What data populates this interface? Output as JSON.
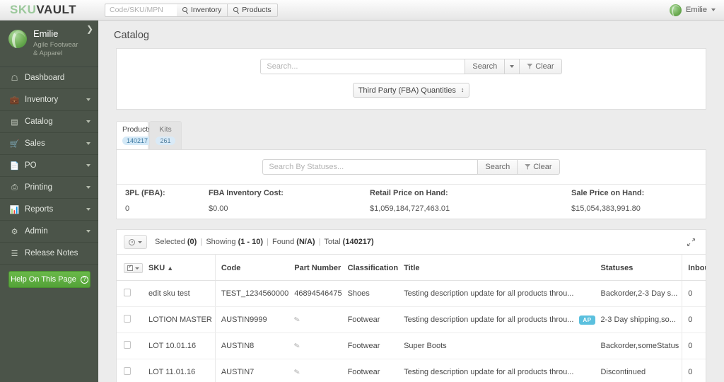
{
  "topbar": {
    "logo_sku": "SKU",
    "logo_vault": "VAULT",
    "search_placeholder": "Code/SKU/MPN",
    "nav": [
      {
        "label": "Inventory",
        "icon": "search-icon"
      },
      {
        "label": "Products",
        "icon": "search-icon"
      }
    ],
    "user_name": "Emilie"
  },
  "sidebar": {
    "profile": {
      "name": "Emilie",
      "subtitle": "Agile Footwear & Apparel"
    },
    "items": [
      {
        "label": "Dashboard",
        "icon": "home-icon",
        "caret": false
      },
      {
        "label": "Inventory",
        "icon": "briefcase-icon",
        "caret": true
      },
      {
        "label": "Catalog",
        "icon": "book-icon",
        "caret": true
      },
      {
        "label": "Sales",
        "icon": "cart-icon",
        "caret": true
      },
      {
        "label": "PO",
        "icon": "file-icon",
        "caret": true
      },
      {
        "label": "Printing",
        "icon": "printer-icon",
        "caret": true
      },
      {
        "label": "Reports",
        "icon": "chart-icon",
        "caret": true
      },
      {
        "label": "Admin",
        "icon": "wrench-icon",
        "caret": true
      },
      {
        "label": "Release Notes",
        "icon": "list-icon",
        "caret": false
      }
    ],
    "help_button": "Help On This Page",
    "accent_green": "#54a238"
  },
  "main": {
    "page_title": "Catalog",
    "search": {
      "placeholder": "Search...",
      "search_button": "Search",
      "clear_button": "Clear",
      "fba_select": "Third Party (FBA) Quantities"
    },
    "tabs": [
      {
        "label": "Products",
        "badge": "140217",
        "active": true
      },
      {
        "label": "Kits",
        "badge": "261",
        "active": false
      }
    ],
    "status_search": {
      "placeholder": "Search By Statuses...",
      "search_button": "Search",
      "clear_button": "Clear"
    },
    "stats": {
      "headers": [
        "3PL (FBA):",
        "FBA Inventory Cost:",
        "Retail Price on Hand:",
        "Sale Price on Hand:"
      ],
      "values": [
        "0",
        "$0.00",
        "$1,059,184,727,463.01",
        "$15,054,383,991.80"
      ]
    },
    "toolbar": {
      "selected_label": "Selected",
      "selected_value": "(0)",
      "showing_label": "Showing",
      "showing_value": "(1 - 10)",
      "found_label": "Found",
      "found_value": "(N/A)",
      "total_label": "Total",
      "total_value": "(140217)"
    },
    "table": {
      "columns": [
        "SKU",
        "Code",
        "Part Number",
        "Classification",
        "Title",
        "Statuses",
        "Inbound"
      ],
      "sort_column": "SKU",
      "sort_direction": "asc",
      "rows": [
        {
          "sku": "edit sku test",
          "code": "TEST_1234560000",
          "part_number": "46894546475",
          "has_pencil": false,
          "classification": "Shoes",
          "title": "Testing description update for all products throu...",
          "badge": "",
          "statuses": "Backorder,2-3 Day s...",
          "inbound": "0"
        },
        {
          "sku": "LOTION MASTER",
          "code": "AUSTIN9999",
          "part_number": "",
          "has_pencil": true,
          "classification": "Footwear",
          "title": "Testing description update for all products throu...",
          "badge": "AP",
          "statuses": "2-3 Day shipping,so...",
          "inbound": "0"
        },
        {
          "sku": "LOT 10.01.16",
          "code": "AUSTIN8",
          "part_number": "",
          "has_pencil": true,
          "classification": "Footwear",
          "title": "Super Boots",
          "badge": "",
          "statuses": "Backorder,someStatus",
          "inbound": "0"
        },
        {
          "sku": "LOT 11.01.16",
          "code": "AUSTIN7",
          "part_number": "",
          "has_pencil": true,
          "classification": "Footwear",
          "title": "Testing description update for all products throu...",
          "badge": "",
          "statuses": "Discontinued",
          "inbound": "0"
        }
      ]
    }
  }
}
